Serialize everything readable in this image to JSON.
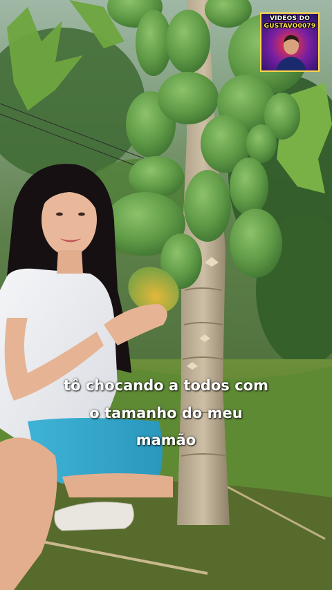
{
  "badge": {
    "line1": "VIDEOS DO",
    "line2": "GUSTAVO0079"
  },
  "caption": {
    "line1": "tô chocando a todos com",
    "line2": "o tamanho do meu",
    "line3": "mamão"
  }
}
